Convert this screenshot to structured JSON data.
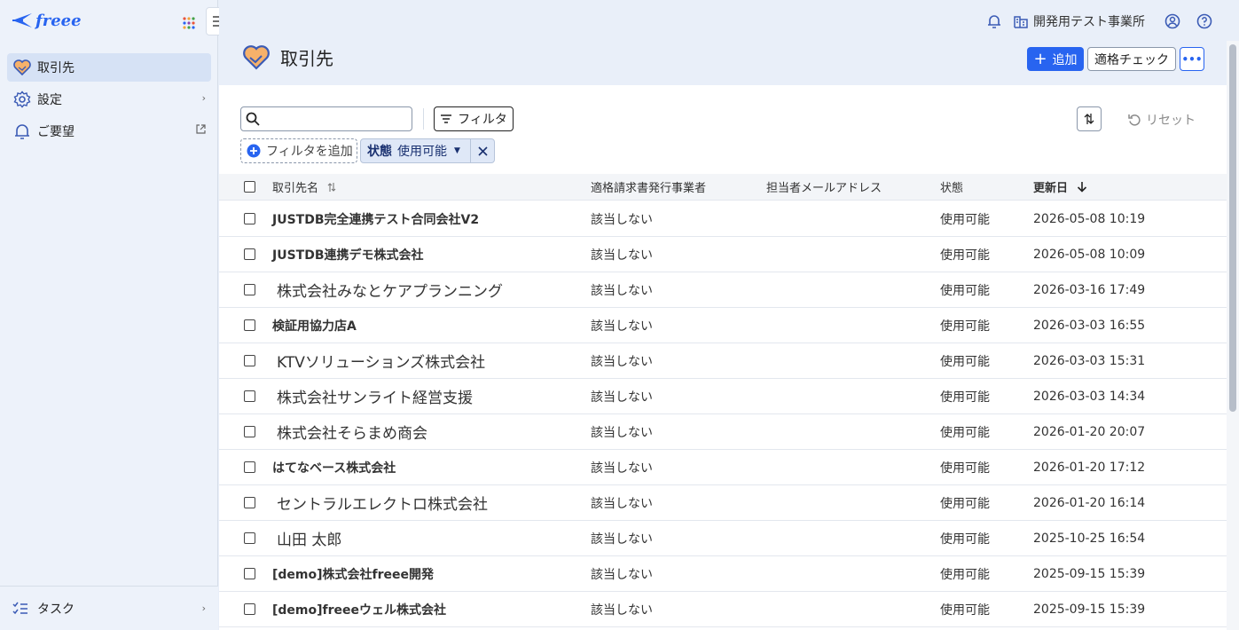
{
  "app": {
    "logo_text": "freee",
    "brand_color": "#2864f0"
  },
  "sidebar": {
    "items": [
      {
        "label": "取引先",
        "icon": "handshake-icon",
        "active": true
      },
      {
        "label": "設定",
        "icon": "gear-icon"
      },
      {
        "label": "ご要望",
        "icon": "bell-icon"
      }
    ],
    "task_label": "タスク"
  },
  "header": {
    "office_name": "開発用テスト事業所",
    "page_title": "取引先",
    "add_label": "追加",
    "check_label": "適格チェック",
    "more_label": "•••"
  },
  "toolbar": {
    "search_value": "",
    "filter_label": "フィルタ",
    "reset_label": "リセット",
    "add_filter_label": "フィルタを追加",
    "chip_key": "状態",
    "chip_value": "使用可能"
  },
  "table": {
    "headers": {
      "name": "取引先名",
      "qualified": "適格請求書発行事業者",
      "email": "担当者メールアドレス",
      "status": "状態",
      "updated": "更新日"
    },
    "rows": [
      {
        "name": "JUSTDB完全連携テスト合同会社V2",
        "qualified": "該当しない",
        "email": "",
        "status": "使用可能",
        "updated": "2026-05-08 10:19",
        "big": false
      },
      {
        "name": "JUSTDB連携デモ株式会社",
        "qualified": "該当しない",
        "email": "",
        "status": "使用可能",
        "updated": "2026-05-08 10:09",
        "big": false
      },
      {
        "name": "株式会社みなとケアプランニング",
        "qualified": "該当しない",
        "email": "",
        "status": "使用可能",
        "updated": "2026-03-16 17:49",
        "big": true
      },
      {
        "name": "検証用協力店A",
        "qualified": "該当しない",
        "email": "",
        "status": "使用可能",
        "updated": "2026-03-03 16:55",
        "big": false
      },
      {
        "name": "KTVソリューションズ株式会社",
        "qualified": "該当しない",
        "email": "",
        "status": "使用可能",
        "updated": "2026-03-03 15:31",
        "big": true
      },
      {
        "name": "株式会社サンライト経営支援",
        "qualified": "該当しない",
        "email": "",
        "status": "使用可能",
        "updated": "2026-03-03 14:34",
        "big": true
      },
      {
        "name": "株式会社そらまめ商会",
        "qualified": "該当しない",
        "email": "",
        "status": "使用可能",
        "updated": "2026-01-20 20:07",
        "big": true
      },
      {
        "name": "はてなベース株式会社",
        "qualified": "該当しない",
        "email": "",
        "status": "使用可能",
        "updated": "2026-01-20 17:12",
        "big": false
      },
      {
        "name": "セントラルエレクトロ株式会社",
        "qualified": "該当しない",
        "email": "",
        "status": "使用可能",
        "updated": "2026-01-20 16:14",
        "big": true
      },
      {
        "name": "山田 太郎",
        "qualified": "該当しない",
        "email": "",
        "status": "使用可能",
        "updated": "2025-10-25 16:54",
        "big": true
      },
      {
        "name": "[demo]株式会社freee開発",
        "qualified": "該当しない",
        "email": "",
        "status": "使用可能",
        "updated": "2025-09-15 15:39",
        "big": false
      },
      {
        "name": "[demo]freeeウェル株式会社",
        "qualified": "該当しない",
        "email": "",
        "status": "使用可能",
        "updated": "2025-09-15 15:39",
        "big": false
      }
    ]
  }
}
